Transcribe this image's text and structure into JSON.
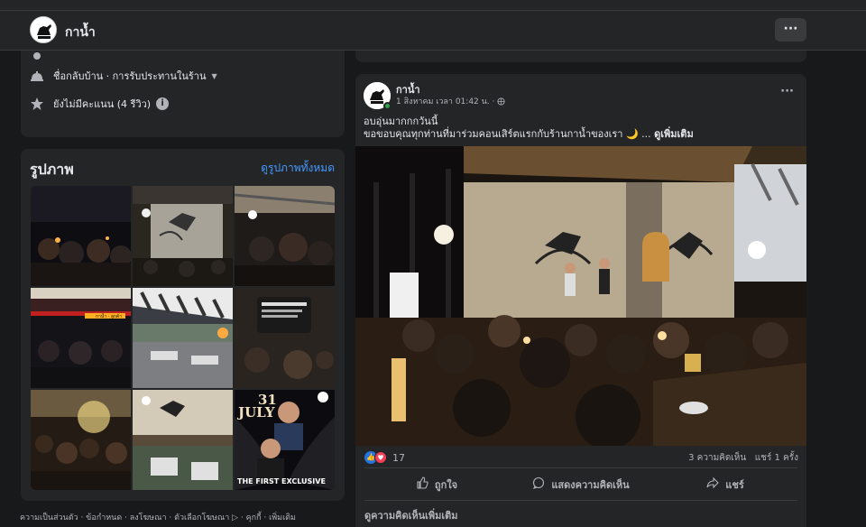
{
  "header": {
    "page_name": "กาน้ำ",
    "more_label": "···"
  },
  "about": {
    "row_hidden": "",
    "category": "ชื่อกลับบ้าน · การรับประทานในร้าน",
    "rating": "ยังไม่มีคะแนน (4 รีวิว)",
    "info_label": "i"
  },
  "photos": {
    "title": "รูปภาพ",
    "see_all": "ดูรูปภาพทั้งหมด",
    "tiles": [
      {
        "scene": "night-crowd"
      },
      {
        "scene": "bird-wall"
      },
      {
        "scene": "crowd-stage"
      },
      {
        "scene": "storefront",
        "sign": "กาน้ำ · ลูกค้า"
      },
      {
        "scene": "terrace"
      },
      {
        "scene": "phone-story"
      },
      {
        "scene": "crowd-bright"
      },
      {
        "scene": "interior"
      },
      {
        "scene": "poster",
        "date_top": "31",
        "date_bottom": "JULY",
        "caption": "THE FIRST EXCLUSIVE"
      }
    ]
  },
  "footer": {
    "links": "ความเป็นส่วนตัว · ข้อกำหนด · ลงโฆษณา · ตัวเลือกโฆษณา ▷ · คุกกี้ · เพิ่มเติม"
  },
  "post": {
    "page_name": "กาน้ำ",
    "time": "1 สิงหาคม เวลา 01:42 น. · ",
    "text_line1": "อบอุ่นมากกกวันนี้",
    "text_line2": "ขอขอบคุณทุกท่านที่มาร่วมคอนเสิร์ตแรกกับร้านกาน้ำของเรา 🌙 ... ",
    "see_more": "ดูเพิ่มเติม",
    "reaction_count": "17",
    "stats": "3 ความคิดเห็น   แชร์ 1 ครั้ง",
    "actions": {
      "like": "ถูกใจ",
      "comment": "แสดงความคิดเห็น",
      "share": "แชร์"
    },
    "more_comments": "ดูความคิดเห็นเพิ่มเติม"
  },
  "icons": {
    "like": "thumbs-up-icon",
    "comment": "comment-icon",
    "share": "share-icon",
    "globe": "globe-icon"
  },
  "colors": {
    "background": "#18191a",
    "card": "#242526",
    "link": "#4599ff",
    "like": "#2374e1",
    "love": "#f33e58",
    "online": "#31a24c"
  }
}
